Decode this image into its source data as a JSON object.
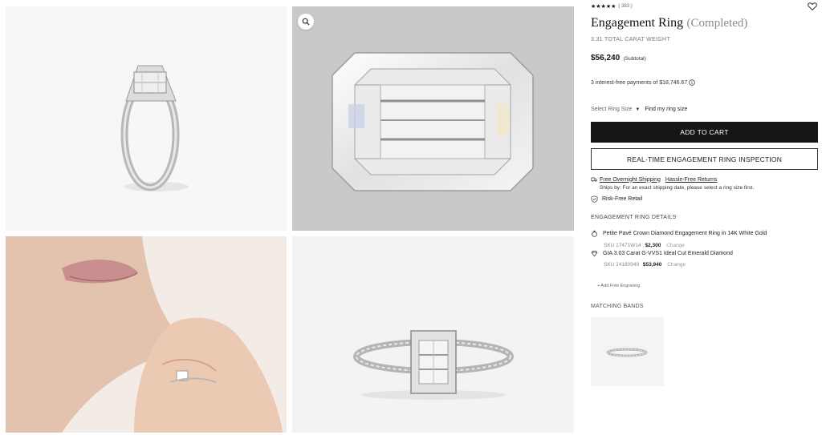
{
  "gallery": {
    "images": [
      {
        "subject": "ring-side-view"
      },
      {
        "subject": "emerald-cut-diamond-closeup"
      },
      {
        "subject": "ring-on-model-hand"
      },
      {
        "subject": "ring-front-view"
      }
    ],
    "zoom_icon": "magnifier-icon"
  },
  "product": {
    "rating_stars": "★★★★★",
    "review_count": "( 383 )",
    "title": "Engagement Ring",
    "status": "(Completed)",
    "carat_weight": "3.31 TOTAL CARAT WEIGHT",
    "price": "$56,240",
    "price_note": "(Subtotal)",
    "payments": "3 interest-free payments of $18,746.67",
    "ring_size_placeholder": "Select Ring Size",
    "find_size_label": "Find my ring size",
    "add_to_cart_label": "ADD TO CART",
    "inspection_label": "REAL-TIME ENGAGEMENT RING INSPECTION",
    "shipping_link": "Free Overnight Shipping",
    "returns_link": "Hassle-Free Returns",
    "ships_by": "Ships by: For an exact shipping date, please select a ring size first.",
    "risk_free": "Risk-Free Retail"
  },
  "details": {
    "heading": "ENGAGEMENT RING DETAILS",
    "items": [
      {
        "name": "Petite Pavé Crown Diamond Engagement Ring in 14K White Gold",
        "sku": "SKU 17471W14",
        "price": "$2,300",
        "action": "Change",
        "icon": "ring-icon"
      },
      {
        "name": "GIA 3.03 Carat G-VVS1 Ideal Cut Emerald Diamond",
        "sku": "SKU 24180949",
        "price": "$53,940",
        "action": "Change",
        "icon": "diamond-icon"
      }
    ],
    "engraving_link": "+ Add Free Engraving"
  },
  "matching": {
    "heading": "MATCHING BANDS"
  },
  "colors": {
    "primary_button": "#161616",
    "background": "#ffffff"
  }
}
